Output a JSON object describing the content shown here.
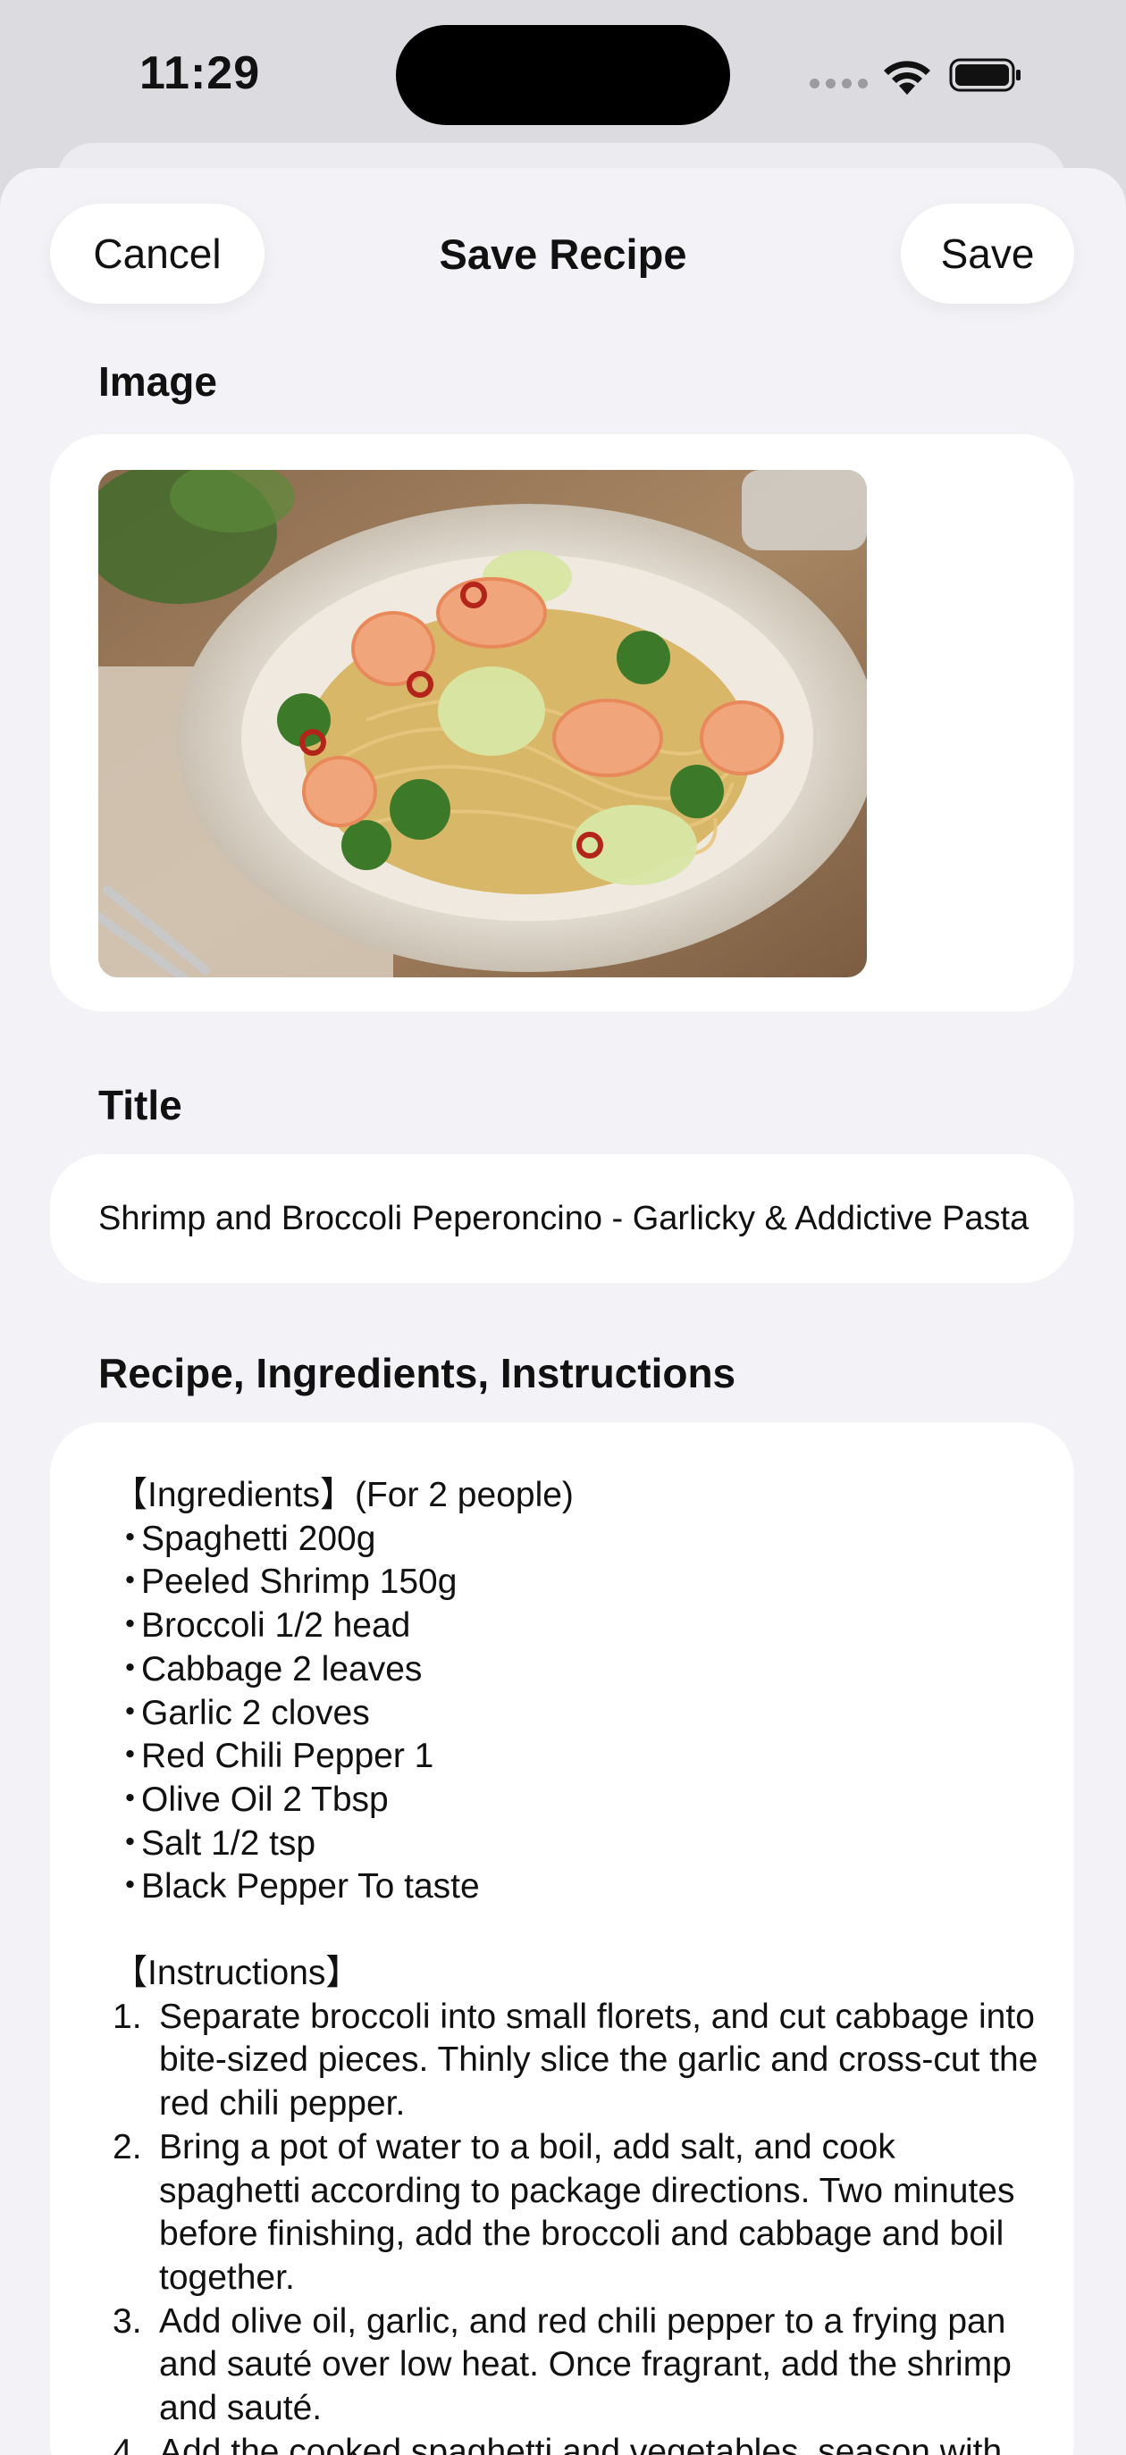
{
  "status_bar": {
    "time": "11:29"
  },
  "header": {
    "cancel_label": "Cancel",
    "title": "Save Recipe",
    "save_label": "Save"
  },
  "sections": {
    "image_label": "Image",
    "title_label": "Title",
    "recipe_label": "Recipe, Ingredients, Instructions"
  },
  "image": {
    "alt": "Shrimp and broccoli pasta in a white ribbed plate"
  },
  "title_value": "Shrimp and Broccoli Peperoncino - Garlicky & Addictive Pasta",
  "recipe": {
    "ingredients_heading": "【Ingredients】(For 2 people)",
    "ingredients": [
      "Spaghetti 200g",
      "Peeled Shrimp 150g",
      "Broccoli 1/2 head",
      "Cabbage 2 leaves",
      "Garlic 2 cloves",
      "Red Chili Pepper 1",
      "Olive Oil 2 Tbsp",
      "Salt 1/2 tsp",
      "Black Pepper To taste"
    ],
    "bullet": "・",
    "instructions_heading": "【Instructions】",
    "steps": [
      {
        "num": "1.",
        "text": "Separate broccoli into small florets, and cut cabbage into bite-sized pieces. Thinly slice the garlic and cross-cut the red chili pepper."
      },
      {
        "num": "2.",
        "text": "Bring a pot of water to a boil, add salt, and cook spaghetti according to package directions. Two minutes before finishing, add the broccoli and cabbage and boil together."
      },
      {
        "num": "3.",
        "text": "Add olive oil, garlic, and red chili pepper to a frying pan and sauté over low heat. Once fragrant, add the shrimp and sauté."
      },
      {
        "num": "4.",
        "text": "Add the cooked spaghetti and vegetables, season with salt and black pepper."
      }
    ]
  },
  "colors": {
    "background": "#f2f2f7",
    "card": "#ffffff",
    "text": "#111111"
  }
}
